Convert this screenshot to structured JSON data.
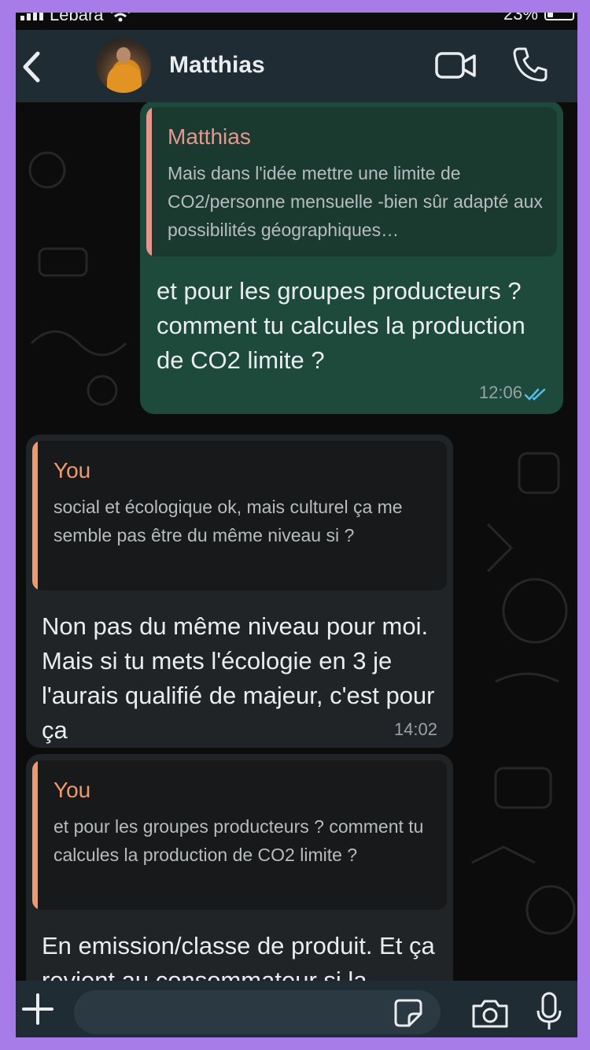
{
  "status_bar": {
    "carrier": "Lebara",
    "battery": "23%"
  },
  "header": {
    "contact_name": "Matthias"
  },
  "messages": [
    {
      "direction": "outgoing",
      "quote": {
        "author": "Matthias",
        "text": "Mais dans l'idée mettre une limite de CO2/personne mensuelle -bien sûr adapté aux possibilités géographiques…"
      },
      "text": "et pour les groupes producteurs ? comment tu calcules la production de CO2 limite ?",
      "time": "12:06",
      "status": "read"
    },
    {
      "direction": "incoming",
      "quote": {
        "author": "You",
        "text": "social et écologique ok, mais culturel ça me semble pas être du même niveau si ?"
      },
      "text": "Non pas du même niveau pour moi. Mais si tu mets l'écologie en 3 je l'aurais qualifié de majeur, c'est pour ça",
      "time": "14:02"
    },
    {
      "direction": "incoming",
      "quote": {
        "author": "You",
        "text": "et pour les groupes producteurs ? comment tu calcules la production de CO2 limite ?"
      },
      "text": "En emission/classe de produit. Et ça revient au consommateur si la",
      "time": ""
    }
  ],
  "colors": {
    "outgoing_bubble": "#1d4a3a",
    "incoming_bubble": "#202427",
    "quote_author_matthias": "#e5978f",
    "quote_author_you": "#ef9a6e",
    "read_ticks": "#53bdeb"
  },
  "icons": {
    "back": "chevron-left-icon",
    "video": "video-camera-icon",
    "call": "phone-icon",
    "plus": "plus-icon",
    "sticker": "sticker-icon",
    "camera": "camera-icon",
    "mic": "microphone-icon"
  }
}
